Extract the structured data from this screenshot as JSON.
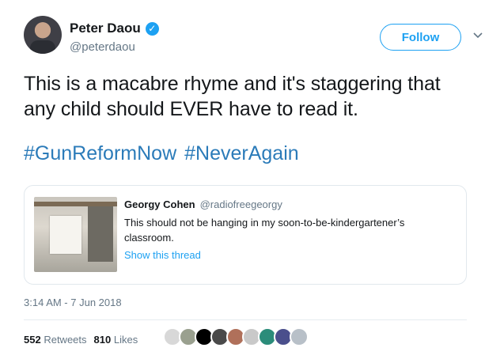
{
  "author": {
    "name": "Peter Daou",
    "handle": "@peterdaou",
    "verified": true
  },
  "follow_label": "Follow",
  "tweet": {
    "text": "This is a macabre rhyme and it's staggering that any child should EVER have to read it.",
    "hashtags": [
      "#GunReformNow",
      "#NeverAgain"
    ]
  },
  "quoted_tweet": {
    "name": "Georgy Cohen",
    "handle": "@radiofreegeorgy",
    "text": "This should not be hanging in my soon-to-be-kindergartener’s classroom.",
    "show_thread_label": "Show this thread"
  },
  "timestamp": "3:14 AM - 7 Jun 2018",
  "stats": {
    "retweets_count": "552",
    "retweets_label": "Retweets",
    "likes_count": "810",
    "likes_label": "Likes"
  },
  "colors": {
    "accent": "#1da1f2",
    "hashtag": "#2b7bb9",
    "muted": "#657786"
  },
  "icons": {
    "verified": "verified-badge-icon",
    "menu": "chevron-down-icon"
  },
  "liker_avatar_colors": [
    "#d8d8d8",
    "#9aa08f",
    "#000000",
    "#4a4a4a",
    "#b0705a",
    "#c9c9c9",
    "#2b8c7a",
    "#4a4f8c",
    "#b8c0c8"
  ]
}
